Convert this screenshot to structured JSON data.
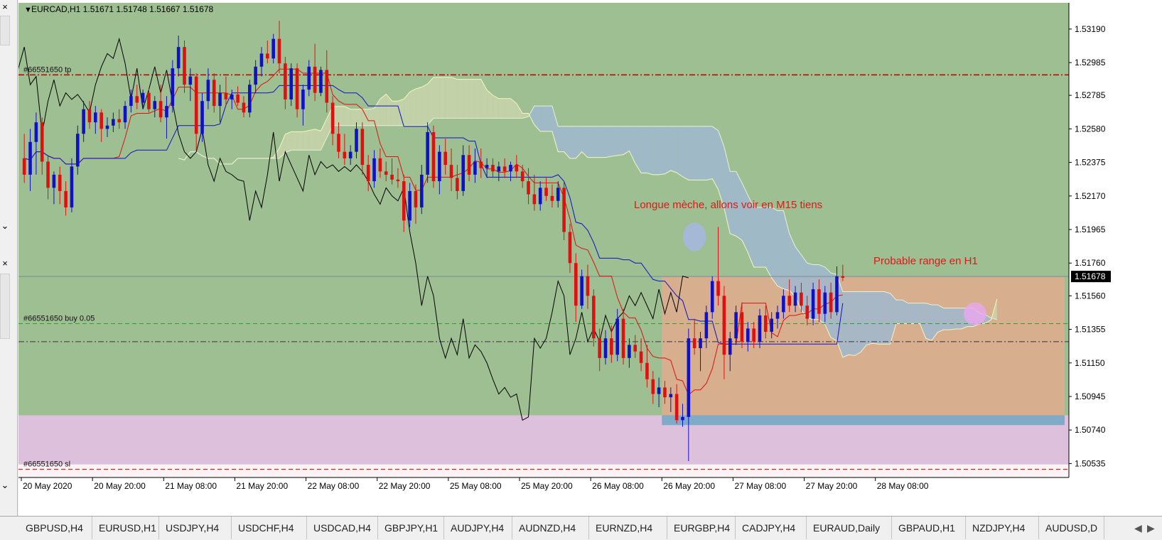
{
  "symbol_header": "EURCAD,H1  1.51671 1.51748 1.51667 1.51678",
  "colors": {
    "background": "#9dbf91",
    "bull": "#1010c8",
    "bear": "#e01010",
    "tenkan": "#e01010",
    "kijun": "#1010c8",
    "chikou": "#000000",
    "kumo_bull": "#c9d3ac",
    "kumo_bear": "#a0b8cf",
    "zone_orange": "#d7ae8e",
    "zone_pink": "#dcc0dc",
    "zone_white": "#fbf3f4",
    "tp_line": "#b00000",
    "buy_line": "#2ca02c",
    "sl_line": "#e02020"
  },
  "legend_marker": "▼",
  "chart_data": {
    "type": "candlestick",
    "timeframe": "H1",
    "y_range": [
      1.5045,
      1.5335
    ],
    "y_ticks": [
      "1.53190",
      "1.52985",
      "1.52785",
      "1.52580",
      "1.52375",
      "1.52170",
      "1.51965",
      "1.51760",
      "1.51560",
      "1.51355",
      "1.51150",
      "1.50945",
      "1.50740",
      "1.50535"
    ],
    "current_price": "1.51678",
    "x_tick_labels": [
      "20 May 2020",
      "20 May 20:00",
      "21 May 08:00",
      "21 May 20:00",
      "22 May 08:00",
      "22 May 20:00",
      "25 May 08:00",
      "25 May 20:00",
      "26 May 08:00",
      "26 May 20:00",
      "27 May 08:00",
      "27 May 20:00",
      "28 May 08:00"
    ],
    "candles": [
      {
        "o": 1.524,
        "h": 1.5255,
        "l": 1.5225,
        "c": 1.523
      },
      {
        "o": 1.523,
        "h": 1.5258,
        "l": 1.522,
        "c": 1.525
      },
      {
        "o": 1.525,
        "h": 1.5268,
        "l": 1.523,
        "c": 1.5262
      },
      {
        "o": 1.5262,
        "h": 1.5265,
        "l": 1.523,
        "c": 1.5238
      },
      {
        "o": 1.5238,
        "h": 1.5242,
        "l": 1.5215,
        "c": 1.5222
      },
      {
        "o": 1.5222,
        "h": 1.5232,
        "l": 1.5212,
        "c": 1.523
      },
      {
        "o": 1.523,
        "h": 1.5235,
        "l": 1.5212,
        "c": 1.522
      },
      {
        "o": 1.522,
        "h": 1.5226,
        "l": 1.5205,
        "c": 1.521
      },
      {
        "o": 1.521,
        "h": 1.524,
        "l": 1.5207,
        "c": 1.5235
      },
      {
        "o": 1.5235,
        "h": 1.526,
        "l": 1.523,
        "c": 1.5255
      },
      {
        "o": 1.5255,
        "h": 1.5275,
        "l": 1.525,
        "c": 1.527
      },
      {
        "o": 1.527,
        "h": 1.5275,
        "l": 1.5258,
        "c": 1.5262
      },
      {
        "o": 1.5262,
        "h": 1.5272,
        "l": 1.5255,
        "c": 1.5268
      },
      {
        "o": 1.5268,
        "h": 1.527,
        "l": 1.525,
        "c": 1.5258
      },
      {
        "o": 1.5258,
        "h": 1.5265,
        "l": 1.5253,
        "c": 1.526
      },
      {
        "o": 1.526,
        "h": 1.5268,
        "l": 1.5256,
        "c": 1.5264
      },
      {
        "o": 1.5264,
        "h": 1.527,
        "l": 1.5258,
        "c": 1.5262
      },
      {
        "o": 1.5262,
        "h": 1.5275,
        "l": 1.5258,
        "c": 1.5272
      },
      {
        "o": 1.5272,
        "h": 1.5282,
        "l": 1.5268,
        "c": 1.5278
      },
      {
        "o": 1.5278,
        "h": 1.5285,
        "l": 1.527,
        "c": 1.5274
      },
      {
        "o": 1.5274,
        "h": 1.5282,
        "l": 1.527,
        "c": 1.528
      },
      {
        "o": 1.528,
        "h": 1.5283,
        "l": 1.5268,
        "c": 1.527
      },
      {
        "o": 1.527,
        "h": 1.5278,
        "l": 1.5265,
        "c": 1.5275
      },
      {
        "o": 1.5275,
        "h": 1.5285,
        "l": 1.5262,
        "c": 1.5265
      },
      {
        "o": 1.5265,
        "h": 1.5278,
        "l": 1.5252,
        "c": 1.5272
      },
      {
        "o": 1.5272,
        "h": 1.53,
        "l": 1.5268,
        "c": 1.5295
      },
      {
        "o": 1.5295,
        "h": 1.5315,
        "l": 1.529,
        "c": 1.5308
      },
      {
        "o": 1.5308,
        "h": 1.5312,
        "l": 1.528,
        "c": 1.5285
      },
      {
        "o": 1.5285,
        "h": 1.5295,
        "l": 1.5275,
        "c": 1.529
      },
      {
        "o": 1.529,
        "h": 1.5292,
        "l": 1.5245,
        "c": 1.5255
      },
      {
        "o": 1.5255,
        "h": 1.528,
        "l": 1.525,
        "c": 1.5275
      },
      {
        "o": 1.5275,
        "h": 1.5295,
        "l": 1.527,
        "c": 1.5288
      },
      {
        "o": 1.5288,
        "h": 1.5292,
        "l": 1.5268,
        "c": 1.5272
      },
      {
        "o": 1.5272,
        "h": 1.5285,
        "l": 1.5262,
        "c": 1.528
      },
      {
        "o": 1.528,
        "h": 1.529,
        "l": 1.5272,
        "c": 1.5276
      },
      {
        "o": 1.5276,
        "h": 1.5282,
        "l": 1.527,
        "c": 1.5279
      },
      {
        "o": 1.5279,
        "h": 1.5284,
        "l": 1.5272,
        "c": 1.5274
      },
      {
        "o": 1.5274,
        "h": 1.5278,
        "l": 1.5265,
        "c": 1.5268
      },
      {
        "o": 1.5268,
        "h": 1.5288,
        "l": 1.5265,
        "c": 1.5285
      },
      {
        "o": 1.5285,
        "h": 1.53,
        "l": 1.528,
        "c": 1.5296
      },
      {
        "o": 1.5296,
        "h": 1.5308,
        "l": 1.529,
        "c": 1.5304
      },
      {
        "o": 1.5304,
        "h": 1.5312,
        "l": 1.5298,
        "c": 1.5301
      },
      {
        "o": 1.5301,
        "h": 1.5316,
        "l": 1.5298,
        "c": 1.5313
      },
      {
        "o": 1.5313,
        "h": 1.5324,
        "l": 1.5292,
        "c": 1.5298
      },
      {
        "o": 1.5298,
        "h": 1.5302,
        "l": 1.527,
        "c": 1.5276
      },
      {
        "o": 1.5276,
        "h": 1.5298,
        "l": 1.5272,
        "c": 1.5295
      },
      {
        "o": 1.5295,
        "h": 1.5298,
        "l": 1.5265,
        "c": 1.527
      },
      {
        "o": 1.527,
        "h": 1.5285,
        "l": 1.526,
        "c": 1.5282
      },
      {
        "o": 1.5282,
        "h": 1.53,
        "l": 1.5278,
        "c": 1.5296
      },
      {
        "o": 1.5296,
        "h": 1.531,
        "l": 1.5275,
        "c": 1.528
      },
      {
        "o": 1.528,
        "h": 1.5296,
        "l": 1.5278,
        "c": 1.5294
      },
      {
        "o": 1.5294,
        "h": 1.5306,
        "l": 1.5268,
        "c": 1.5274
      },
      {
        "o": 1.5274,
        "h": 1.5278,
        "l": 1.5248,
        "c": 1.5255
      },
      {
        "o": 1.5255,
        "h": 1.5262,
        "l": 1.524,
        "c": 1.5244
      },
      {
        "o": 1.5244,
        "h": 1.5255,
        "l": 1.5236,
        "c": 1.524
      },
      {
        "o": 1.524,
        "h": 1.5248,
        "l": 1.5236,
        "c": 1.5244
      },
      {
        "o": 1.5244,
        "h": 1.5262,
        "l": 1.524,
        "c": 1.5258
      },
      {
        "o": 1.5258,
        "h": 1.5262,
        "l": 1.523,
        "c": 1.5236
      },
      {
        "o": 1.5236,
        "h": 1.5242,
        "l": 1.522,
        "c": 1.5226
      },
      {
        "o": 1.5226,
        "h": 1.5245,
        "l": 1.5222,
        "c": 1.524
      },
      {
        "o": 1.524,
        "h": 1.5246,
        "l": 1.5228,
        "c": 1.5232
      },
      {
        "o": 1.5232,
        "h": 1.5238,
        "l": 1.5226,
        "c": 1.523
      },
      {
        "o": 1.523,
        "h": 1.524,
        "l": 1.5224,
        "c": 1.5227
      },
      {
        "o": 1.5227,
        "h": 1.5234,
        "l": 1.5222,
        "c": 1.5226
      },
      {
        "o": 1.5226,
        "h": 1.523,
        "l": 1.5195,
        "c": 1.5202
      },
      {
        "o": 1.5202,
        "h": 1.5225,
        "l": 1.5198,
        "c": 1.522
      },
      {
        "o": 1.522,
        "h": 1.5224,
        "l": 1.52,
        "c": 1.521
      },
      {
        "o": 1.521,
        "h": 1.5236,
        "l": 1.5206,
        "c": 1.523
      },
      {
        "o": 1.523,
        "h": 1.5262,
        "l": 1.5225,
        "c": 1.5256
      },
      {
        "o": 1.5256,
        "h": 1.526,
        "l": 1.5222,
        "c": 1.5226
      },
      {
        "o": 1.5226,
        "h": 1.5248,
        "l": 1.5218,
        "c": 1.5244
      },
      {
        "o": 1.5244,
        "h": 1.5252,
        "l": 1.523,
        "c": 1.5236
      },
      {
        "o": 1.5236,
        "h": 1.5246,
        "l": 1.522,
        "c": 1.5228
      },
      {
        "o": 1.5228,
        "h": 1.5236,
        "l": 1.5215,
        "c": 1.522
      },
      {
        "o": 1.522,
        "h": 1.5248,
        "l": 1.5217,
        "c": 1.5242
      },
      {
        "o": 1.5242,
        "h": 1.5248,
        "l": 1.5226,
        "c": 1.523
      },
      {
        "o": 1.523,
        "h": 1.5246,
        "l": 1.5225,
        "c": 1.5238
      },
      {
        "o": 1.5238,
        "h": 1.5246,
        "l": 1.5228,
        "c": 1.5234
      },
      {
        "o": 1.5234,
        "h": 1.524,
        "l": 1.5228,
        "c": 1.5236
      },
      {
        "o": 1.5236,
        "h": 1.524,
        "l": 1.5228,
        "c": 1.5232
      },
      {
        "o": 1.5232,
        "h": 1.5238,
        "l": 1.5226,
        "c": 1.5235
      },
      {
        "o": 1.5235,
        "h": 1.524,
        "l": 1.5228,
        "c": 1.5232
      },
      {
        "o": 1.5232,
        "h": 1.5238,
        "l": 1.5226,
        "c": 1.5236
      },
      {
        "o": 1.5236,
        "h": 1.5242,
        "l": 1.5228,
        "c": 1.5232
      },
      {
        "o": 1.5232,
        "h": 1.5236,
        "l": 1.5222,
        "c": 1.5226
      },
      {
        "o": 1.5226,
        "h": 1.5234,
        "l": 1.5212,
        "c": 1.5218
      },
      {
        "o": 1.5218,
        "h": 1.523,
        "l": 1.5208,
        "c": 1.5212
      },
      {
        "o": 1.5212,
        "h": 1.5226,
        "l": 1.5208,
        "c": 1.5222
      },
      {
        "o": 1.5222,
        "h": 1.5228,
        "l": 1.5214,
        "c": 1.5217
      },
      {
        "o": 1.5217,
        "h": 1.5224,
        "l": 1.521,
        "c": 1.5214
      },
      {
        "o": 1.5214,
        "h": 1.5226,
        "l": 1.521,
        "c": 1.5222
      },
      {
        "o": 1.5222,
        "h": 1.5226,
        "l": 1.519,
        "c": 1.5195
      },
      {
        "o": 1.5195,
        "h": 1.52,
        "l": 1.517,
        "c": 1.5176
      },
      {
        "o": 1.5176,
        "h": 1.5182,
        "l": 1.514,
        "c": 1.515
      },
      {
        "o": 1.515,
        "h": 1.5172,
        "l": 1.5148,
        "c": 1.5168
      },
      {
        "o": 1.5168,
        "h": 1.5175,
        "l": 1.5148,
        "c": 1.5156
      },
      {
        "o": 1.5156,
        "h": 1.516,
        "l": 1.5125,
        "c": 1.513
      },
      {
        "o": 1.513,
        "h": 1.5136,
        "l": 1.511,
        "c": 1.5118
      },
      {
        "o": 1.5118,
        "h": 1.5135,
        "l": 1.5114,
        "c": 1.513
      },
      {
        "o": 1.513,
        "h": 1.5138,
        "l": 1.5115,
        "c": 1.512
      },
      {
        "o": 1.512,
        "h": 1.5148,
        "l": 1.5116,
        "c": 1.5142
      },
      {
        "o": 1.5142,
        "h": 1.5148,
        "l": 1.5114,
        "c": 1.5118
      },
      {
        "o": 1.5118,
        "h": 1.513,
        "l": 1.5112,
        "c": 1.5126
      },
      {
        "o": 1.5126,
        "h": 1.5132,
        "l": 1.5118,
        "c": 1.5122
      },
      {
        "o": 1.5122,
        "h": 1.513,
        "l": 1.511,
        "c": 1.5115
      },
      {
        "o": 1.5115,
        "h": 1.5126,
        "l": 1.51,
        "c": 1.5105
      },
      {
        "o": 1.5105,
        "h": 1.511,
        "l": 1.509,
        "c": 1.5096
      },
      {
        "o": 1.5096,
        "h": 1.5106,
        "l": 1.5088,
        "c": 1.51
      },
      {
        "o": 1.51,
        "h": 1.5104,
        "l": 1.509,
        "c": 1.5094
      },
      {
        "o": 1.5094,
        "h": 1.51,
        "l": 1.5085,
        "c": 1.5096
      },
      {
        "o": 1.5096,
        "h": 1.5102,
        "l": 1.5078,
        "c": 1.508
      },
      {
        "o": 1.508,
        "h": 1.509,
        "l": 1.5076,
        "c": 1.5082
      },
      {
        "o": 1.5082,
        "h": 1.5136,
        "l": 1.5055,
        "c": 1.513
      },
      {
        "o": 1.513,
        "h": 1.5142,
        "l": 1.512,
        "c": 1.5124
      },
      {
        "o": 1.5124,
        "h": 1.5134,
        "l": 1.511,
        "c": 1.513
      },
      {
        "o": 1.513,
        "h": 1.515,
        "l": 1.5124,
        "c": 1.5146
      },
      {
        "o": 1.5146,
        "h": 1.5168,
        "l": 1.5142,
        "c": 1.5165
      },
      {
        "o": 1.5165,
        "h": 1.5198,
        "l": 1.515,
        "c": 1.5156
      },
      {
        "o": 1.5156,
        "h": 1.5162,
        "l": 1.5105,
        "c": 1.512
      },
      {
        "o": 1.512,
        "h": 1.5134,
        "l": 1.511,
        "c": 1.513
      },
      {
        "o": 1.513,
        "h": 1.515,
        "l": 1.5126,
        "c": 1.5146
      },
      {
        "o": 1.5146,
        "h": 1.5152,
        "l": 1.5124,
        "c": 1.5128
      },
      {
        "o": 1.5128,
        "h": 1.514,
        "l": 1.5122,
        "c": 1.5136
      },
      {
        "o": 1.5136,
        "h": 1.514,
        "l": 1.5124,
        "c": 1.5128
      },
      {
        "o": 1.5128,
        "h": 1.5148,
        "l": 1.5124,
        "c": 1.5144
      },
      {
        "o": 1.5144,
        "h": 1.515,
        "l": 1.513,
        "c": 1.5134
      },
      {
        "o": 1.5134,
        "h": 1.5146,
        "l": 1.513,
        "c": 1.5142
      },
      {
        "o": 1.5142,
        "h": 1.515,
        "l": 1.5136,
        "c": 1.5146
      },
      {
        "o": 1.5146,
        "h": 1.516,
        "l": 1.5142,
        "c": 1.5156
      },
      {
        "o": 1.5156,
        "h": 1.5166,
        "l": 1.5146,
        "c": 1.515
      },
      {
        "o": 1.515,
        "h": 1.5162,
        "l": 1.5146,
        "c": 1.5158
      },
      {
        "o": 1.5158,
        "h": 1.5164,
        "l": 1.5146,
        "c": 1.515
      },
      {
        "o": 1.515,
        "h": 1.5156,
        "l": 1.5138,
        "c": 1.5142
      },
      {
        "o": 1.5142,
        "h": 1.5164,
        "l": 1.5138,
        "c": 1.516
      },
      {
        "o": 1.516,
        "h": 1.5166,
        "l": 1.514,
        "c": 1.5145
      },
      {
        "o": 1.5145,
        "h": 1.5162,
        "l": 1.514,
        "c": 1.5158
      },
      {
        "o": 1.5158,
        "h": 1.5164,
        "l": 1.5142,
        "c": 1.5146
      },
      {
        "o": 1.5146,
        "h": 1.5174,
        "l": 1.5144,
        "c": 1.5168
      },
      {
        "o": 1.5168,
        "h": 1.5175,
        "l": 1.5165,
        "c": 1.5167
      }
    ],
    "order_levels": [
      {
        "label": "#66551650 tp",
        "price": 1.5291
      },
      {
        "label": "#66551650 buy 0.05",
        "price": 1.5139
      },
      {
        "label": "#66551650 sl",
        "price": 1.505
      }
    ]
  },
  "annotations": {
    "long_wick": "Longue mèche, allons voir en M15 tiens",
    "range": "Probable range en H1"
  },
  "tabs": [
    "GBPUSD,H4",
    "EURUSD,H1",
    "USDJPY,H4",
    "USDCHF,H4",
    "USDCAD,H4",
    "GBPJPY,H1",
    "AUDJPY,H4",
    "AUDNZD,H4",
    "EURNZD,H4",
    "EURGBP,H4",
    "CADJPY,H4",
    "EURAUD,Daily",
    "GBPAUD,H1",
    "NZDJPY,H4",
    "AUDUSD,D"
  ],
  "leftbar_icons": {
    "close_top": "×",
    "close_mid": "×",
    "scroll_down": "⌄"
  },
  "tab_scroll": {
    "left": "◀",
    "right": "▶"
  }
}
